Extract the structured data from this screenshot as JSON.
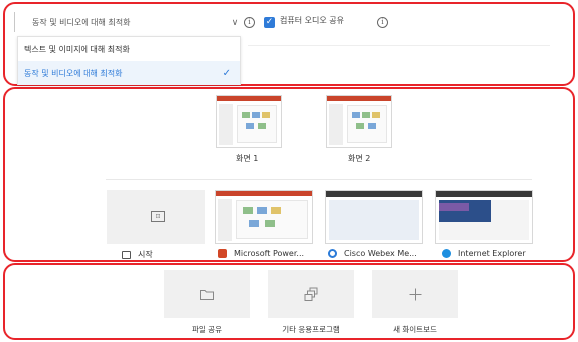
{
  "top": {
    "optimize_select": {
      "value": "동작 및 비디오에 대해 최적화",
      "options": [
        "텍스트 및 이미지에 대해 최적화",
        "동작 및 비디오에 대해 최적화"
      ],
      "selected_index": 1
    },
    "computer_audio": {
      "label": "컴퓨터 오디오 공유",
      "checked": true
    }
  },
  "screens": [
    {
      "label": "화면 1"
    },
    {
      "label": "화면 2"
    }
  ],
  "apps": [
    {
      "label": "시작",
      "icon": "window-icon"
    },
    {
      "label": "Microsoft Power...",
      "icon": "powerpoint-icon"
    },
    {
      "label": "Cisco Webex Me...",
      "icon": "webex-icon"
    },
    {
      "label": "Internet Explorer",
      "icon": "internet-explorer-icon"
    }
  ],
  "actions": [
    {
      "label": "파일 공유",
      "icon": "folder-icon"
    },
    {
      "label": "기타 응용프로그램",
      "icon": "app-windows-icon"
    },
    {
      "label": "새 화이트보드",
      "icon": "plus-icon"
    }
  ],
  "colors": {
    "highlight": "#e8242a",
    "accent": "#2f7bd8"
  }
}
